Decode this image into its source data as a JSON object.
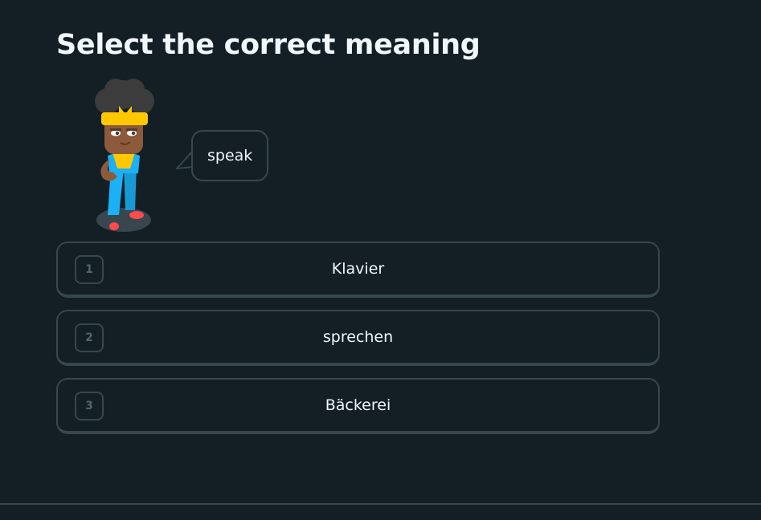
{
  "lesson": {
    "title": "Select the correct meaning",
    "prompt_word": "speak"
  },
  "choices": [
    {
      "key": "1",
      "label": "Klavier"
    },
    {
      "key": "2",
      "label": "sprechen"
    },
    {
      "key": "3",
      "label": "Bäckerei"
    }
  ],
  "colors": {
    "background": "#131f24",
    "border": "#37464f",
    "text": "#f1f7fb",
    "key_text": "#52656d"
  }
}
